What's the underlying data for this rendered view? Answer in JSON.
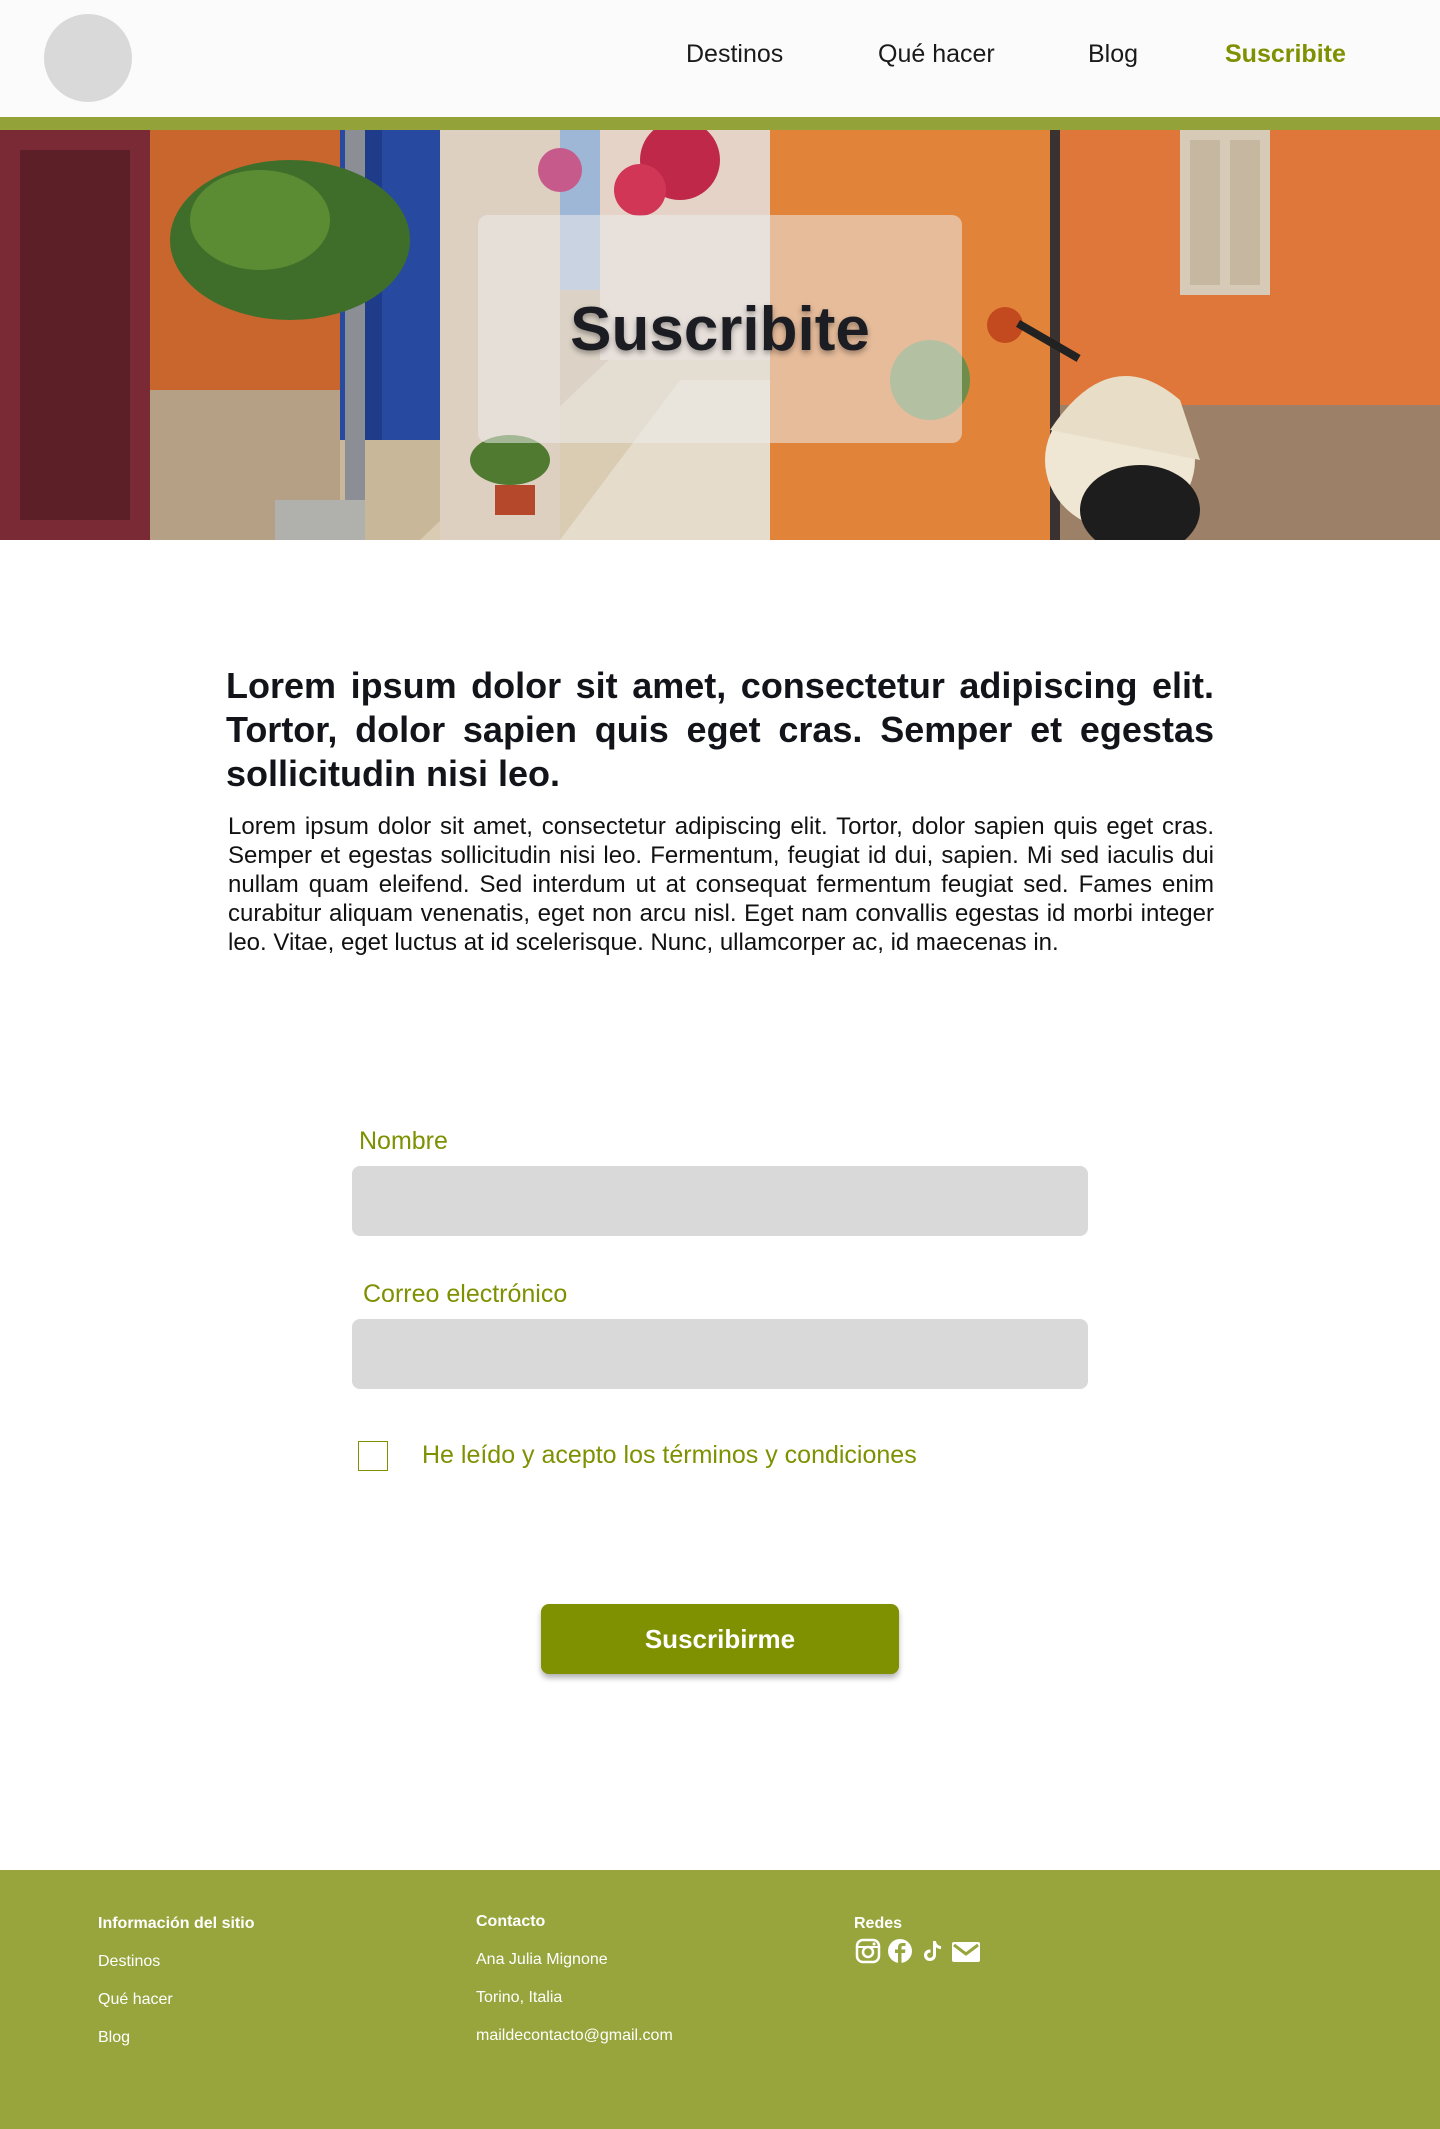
{
  "nav": {
    "items": [
      {
        "label": "Destinos"
      },
      {
        "label": "Qué hacer"
      },
      {
        "label": "Blog"
      },
      {
        "label": "Suscribite",
        "active": true
      }
    ],
    "accent_color": "#7f9000"
  },
  "hero": {
    "title": "Suscribite"
  },
  "content": {
    "headline": "Lorem ipsum dolor sit amet, consectetur adipiscing elit. Tortor, dolor sapien quis eget cras. Semper et egestas sollicitudin nisi leo.",
    "body": "Lorem ipsum dolor sit amet, consectetur adipiscing elit. Tortor, dolor sapien quis eget cras. Semper et egestas sollicitudin nisi leo. Fermentum, feugiat id dui, sapien. Mi sed iaculis dui nullam quam eleifend. Sed interdum ut at consequat fermentum feugiat sed. Fames enim curabitur aliquam venenatis, eget non arcu nisl. Eget nam convallis egestas id morbi integer leo. Vitae, eget luctus at id scelerisque. Nunc, ullamcorper ac, id maecenas in."
  },
  "form": {
    "name_label": "Nombre",
    "name_value": "",
    "email_label": "Correo electrónico",
    "email_value": "",
    "terms_label": "He leído y acepto los términos y condiciones",
    "terms_checked": false,
    "submit_label": "Suscribirme"
  },
  "footer": {
    "background_color": "#97a53c",
    "info": {
      "title": "Información del sitio",
      "links": [
        "Destinos",
        "Qué hacer",
        "Blog"
      ]
    },
    "contact": {
      "title": "Contacto",
      "lines": [
        "Ana Julia Mignone",
        "Torino, Italia",
        "maildecontacto@gmail.com"
      ]
    },
    "social": {
      "title": "Redes",
      "icons": [
        "instagram-icon",
        "facebook-icon",
        "tiktok-icon",
        "mail-icon"
      ]
    }
  }
}
